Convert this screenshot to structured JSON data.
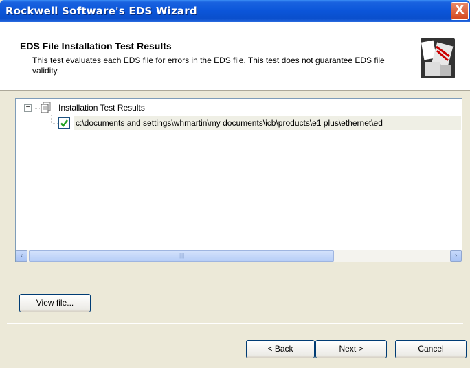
{
  "window": {
    "title": "Rockwell Software's EDS Wizard",
    "close_glyph": "X"
  },
  "header": {
    "title": "EDS File Installation Test Results",
    "description": "This test evaluates each EDS file for errors in the EDS file. This test does not guarantee EDS file validity."
  },
  "tree": {
    "root": {
      "toggle": "−",
      "label": "Installation Test Results",
      "icon": "document-stack-icon"
    },
    "children": [
      {
        "status": "passed",
        "icon": "checkbox-checked-icon",
        "label": "c:\\documents and settings\\whmartin\\my documents\\icb\\products\\e1 plus\\ethernet\\ed"
      }
    ]
  },
  "scrollbar": {
    "left_glyph": "‹",
    "right_glyph": "›",
    "grip_glyph": "||||"
  },
  "buttons": {
    "view_file": "View file...",
    "back": "< Back",
    "next": "Next >",
    "cancel": "Cancel"
  },
  "colors": {
    "title_bar": "#0A4FCC",
    "dialog_bg": "#ECE9D8",
    "check": "#21A121",
    "close": "#D3481F"
  }
}
